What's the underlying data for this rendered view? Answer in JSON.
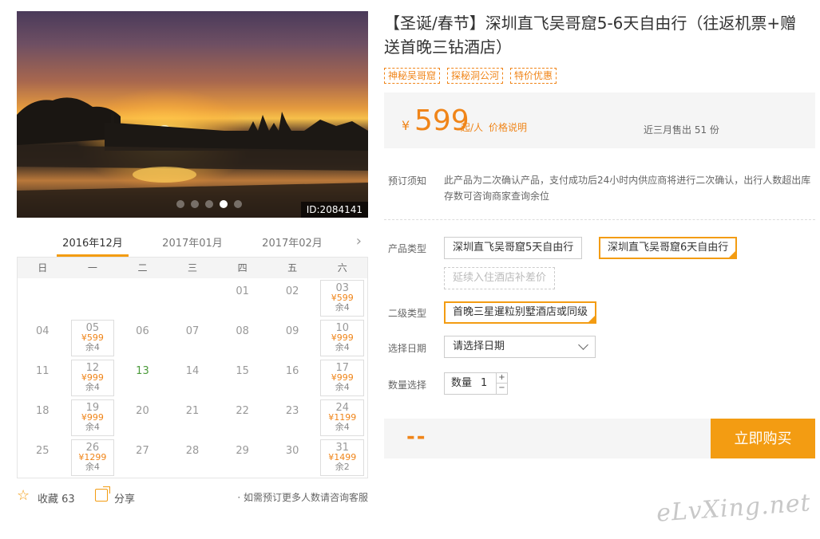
{
  "hero": {
    "id_label": "ID:2084141",
    "dots": 5,
    "active_dot": 3
  },
  "calendar": {
    "months": [
      "2016年12月",
      "2017年01月",
      "2017年02月"
    ],
    "active_month": 0,
    "weekdays": [
      "日",
      "一",
      "二",
      "三",
      "四",
      "五",
      "六"
    ],
    "weeks": [
      [
        {
          "d": ""
        },
        {
          "d": ""
        },
        {
          "d": ""
        },
        {
          "d": ""
        },
        {
          "d": "01"
        },
        {
          "d": "02"
        },
        {
          "d": "03",
          "p": "¥599",
          "r": "余4"
        }
      ],
      [
        {
          "d": "04"
        },
        {
          "d": "05",
          "p": "¥599",
          "r": "余4"
        },
        {
          "d": "06"
        },
        {
          "d": "07"
        },
        {
          "d": "08"
        },
        {
          "d": "09"
        },
        {
          "d": "10",
          "p": "¥999",
          "r": "余4"
        }
      ],
      [
        {
          "d": "11"
        },
        {
          "d": "12",
          "p": "¥999",
          "r": "余4"
        },
        {
          "d": "13",
          "green": true
        },
        {
          "d": "14"
        },
        {
          "d": "15"
        },
        {
          "d": "16"
        },
        {
          "d": "17",
          "p": "¥999",
          "r": "余4"
        }
      ],
      [
        {
          "d": "18"
        },
        {
          "d": "19",
          "p": "¥999",
          "r": "余4"
        },
        {
          "d": "20"
        },
        {
          "d": "21"
        },
        {
          "d": "22"
        },
        {
          "d": "23"
        },
        {
          "d": "24",
          "p": "¥1199",
          "r": "余4"
        }
      ],
      [
        {
          "d": "25"
        },
        {
          "d": "26",
          "p": "¥1299",
          "r": "余4"
        },
        {
          "d": "27"
        },
        {
          "d": "28"
        },
        {
          "d": "29"
        },
        {
          "d": "30"
        },
        {
          "d": "31",
          "p": "¥1499",
          "r": "余2"
        }
      ]
    ]
  },
  "footer": {
    "favorite_label": "收藏 63",
    "share_label": "分享",
    "consult_text": "· 如需预订更多人数请咨询客服"
  },
  "product": {
    "title": "【圣诞/春节】深圳直飞吴哥窟5-6天自由行（往返机票+赠送首晚三钻酒店）",
    "tags": [
      "神秘吴哥窟",
      "探秘洞公河",
      "特价优惠"
    ],
    "currency": "¥",
    "price": "599",
    "price_unit": "起/人",
    "price_note": "价格说明",
    "sold_text": "近三月售出 51 份",
    "notice_label": "预订须知",
    "notice_text": "此产品为二次确认产品，支付成功后24小时内供应商将进行二次确认，出行人数超出库存数可咨询商家查询余位",
    "type_label": "产品类型",
    "type_options": [
      "深圳直飞吴哥窟5天自由行",
      "深圳直飞吴哥窟6天自由行",
      "延续入住酒店补差价"
    ],
    "subtype_label": "二级类型",
    "subtype_option": "首晚三星暹粒别墅酒店或同级",
    "date_label": "选择日期",
    "date_placeholder": "请选择日期",
    "qty_label": "数量选择",
    "qty_prefix": "数量",
    "qty_value": "1",
    "qty_plus": "+",
    "qty_minus": "−",
    "total_placeholder": "--",
    "buy_label": "立即购买"
  },
  "watermark": "eLvXing.net",
  "colors": {
    "accent": "#f39c12",
    "price": "#f08519",
    "green_date": "#4b9a3a"
  }
}
